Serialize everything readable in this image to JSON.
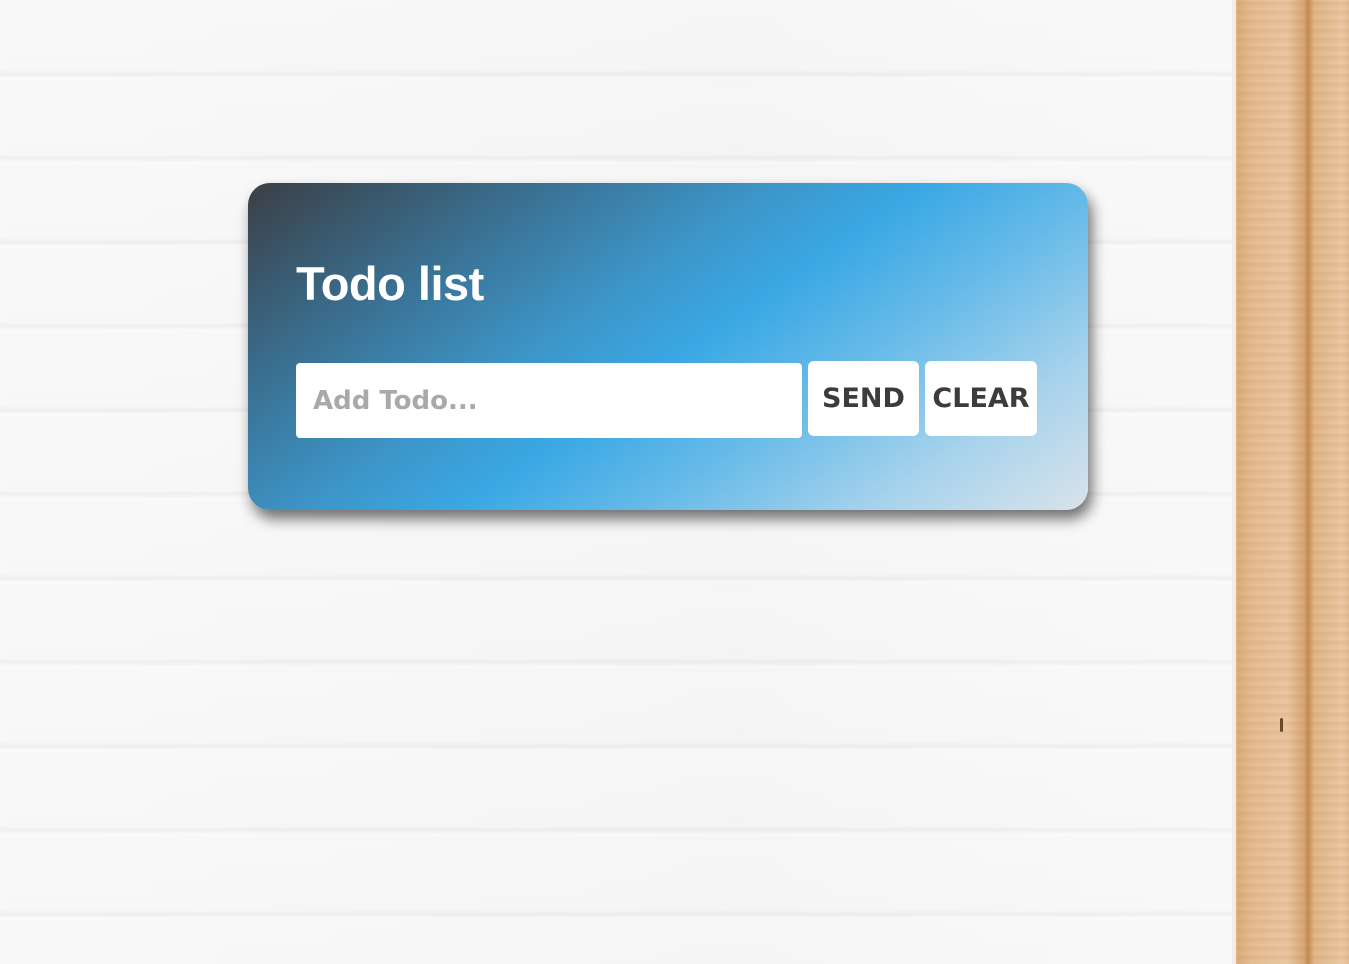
{
  "card": {
    "title": "Todo list",
    "input": {
      "placeholder": "Add Todo...",
      "value": ""
    },
    "send_label": "SEND",
    "clear_label": "CLEAR"
  },
  "colors": {
    "gradient_start": "#3b3f45",
    "gradient_mid": "#3aa8e4",
    "gradient_end": "#d8e3ea",
    "button_text": "#3c3c3c",
    "placeholder_text": "#a9a9a9"
  }
}
